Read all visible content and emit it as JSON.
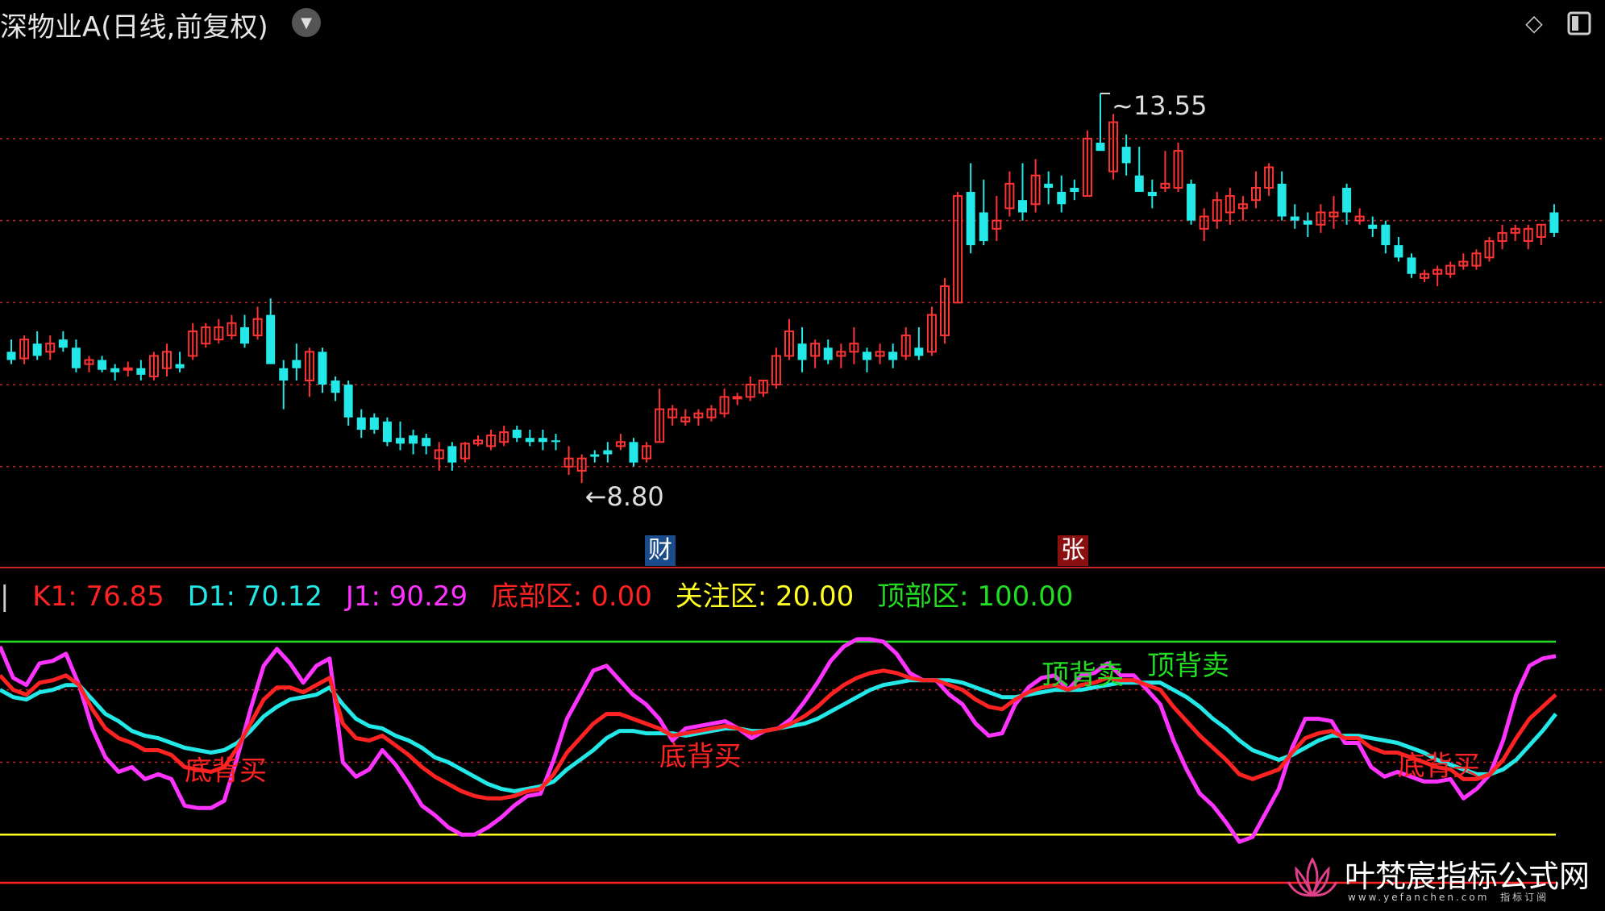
{
  "header": {
    "title": "深物业A(日线,前复权)"
  },
  "badges": {
    "cai": "财",
    "zhang": "张"
  },
  "legend": [
    {
      "key": "k1",
      "text": "K1: 76.85",
      "color": "#ff2222"
    },
    {
      "key": "d1",
      "text": "D1: 70.12",
      "color": "#22e8e8"
    },
    {
      "key": "j1",
      "text": "J1: 90.29",
      "color": "#ff33ff"
    },
    {
      "key": "bottom",
      "text": "底部区: 0.00",
      "color": "#ff2222"
    },
    {
      "key": "watch",
      "text": "关注区: 20.00",
      "color": "#ffff22"
    },
    {
      "key": "top",
      "text": "顶部区: 100.00",
      "color": "#22dd22"
    }
  ],
  "brand": {
    "name": "叶梵宸指标公式网",
    "sub": "www.yefanchen.com",
    "sub2": "指标订阅"
  },
  "colors": {
    "up": "#ff3333",
    "down": "#22e8e8",
    "k": "#ff2222",
    "d": "#22e8e8",
    "j": "#ff33ff",
    "grid": "#cc2222",
    "top": "#22dd22",
    "watch": "#ffff22",
    "bottom": "#ff2222"
  },
  "chart_data": [
    {
      "type": "candlestick",
      "title": "",
      "annotations": [
        {
          "label": "13.55",
          "kind": "high"
        },
        {
          "label": "8.80",
          "kind": "low"
        }
      ],
      "ylim": [
        8.3,
        14.1
      ],
      "candles": [
        [
          10.4,
          10.55,
          10.25,
          10.3
        ],
        [
          10.32,
          10.6,
          10.25,
          10.55
        ],
        [
          10.5,
          10.65,
          10.3,
          10.35
        ],
        [
          10.4,
          10.6,
          10.3,
          10.5
        ],
        [
          10.55,
          10.65,
          10.4,
          10.45
        ],
        [
          10.45,
          10.55,
          10.15,
          10.2
        ],
        [
          10.25,
          10.35,
          10.15,
          10.3
        ],
        [
          10.3,
          10.35,
          10.15,
          10.18
        ],
        [
          10.2,
          10.25,
          10.05,
          10.15
        ],
        [
          10.18,
          10.28,
          10.1,
          10.2
        ],
        [
          10.2,
          10.3,
          10.05,
          10.12
        ],
        [
          10.1,
          10.4,
          10.05,
          10.35
        ],
        [
          10.2,
          10.5,
          10.1,
          10.4
        ],
        [
          10.25,
          10.4,
          10.15,
          10.2
        ],
        [
          10.35,
          10.75,
          10.3,
          10.65
        ],
        [
          10.5,
          10.75,
          10.45,
          10.7
        ],
        [
          10.55,
          10.8,
          10.5,
          10.7
        ],
        [
          10.6,
          10.85,
          10.55,
          10.75
        ],
        [
          10.7,
          10.85,
          10.45,
          10.5
        ],
        [
          10.6,
          10.95,
          10.55,
          10.8
        ],
        [
          10.85,
          11.05,
          10.35,
          10.25
        ],
        [
          10.2,
          10.3,
          9.7,
          10.05
        ],
        [
          10.3,
          10.5,
          10.05,
          10.2
        ],
        [
          10.05,
          10.45,
          9.85,
          10.4
        ],
        [
          10.4,
          10.45,
          9.9,
          10.0
        ],
        [
          10.05,
          10.1,
          9.8,
          9.9
        ],
        [
          10.0,
          10.05,
          9.5,
          9.6
        ],
        [
          9.6,
          9.7,
          9.35,
          9.45
        ],
        [
          9.6,
          9.65,
          9.4,
          9.45
        ],
        [
          9.55,
          9.6,
          9.25,
          9.3
        ],
        [
          9.35,
          9.55,
          9.2,
          9.28
        ],
        [
          9.38,
          9.45,
          9.15,
          9.28
        ],
        [
          9.35,
          9.4,
          9.15,
          9.25
        ],
        [
          9.1,
          9.3,
          8.95,
          9.2
        ],
        [
          9.25,
          9.3,
          8.95,
          9.05
        ],
        [
          9.1,
          9.3,
          9.05,
          9.28
        ],
        [
          9.28,
          9.38,
          9.25,
          9.32
        ],
        [
          9.25,
          9.45,
          9.2,
          9.38
        ],
        [
          9.3,
          9.5,
          9.25,
          9.42
        ],
        [
          9.45,
          9.5,
          9.3,
          9.35
        ],
        [
          9.35,
          9.45,
          9.25,
          9.3
        ],
        [
          9.35,
          9.45,
          9.2,
          9.3
        ],
        [
          9.32,
          9.4,
          9.2,
          9.3
        ],
        [
          9.0,
          9.25,
          8.9,
          9.1
        ],
        [
          8.95,
          9.15,
          8.8,
          9.1
        ],
        [
          9.15,
          9.2,
          9.05,
          9.12
        ],
        [
          9.2,
          9.3,
          9.05,
          9.15
        ],
        [
          9.25,
          9.4,
          9.2,
          9.3
        ],
        [
          9.3,
          9.35,
          9.0,
          9.05
        ],
        [
          9.1,
          9.3,
          9.05,
          9.25
        ],
        [
          9.3,
          9.95,
          9.3,
          9.7
        ],
        [
          9.6,
          9.75,
          9.5,
          9.7
        ],
        [
          9.55,
          9.7,
          9.5,
          9.6
        ],
        [
          9.6,
          9.7,
          9.5,
          9.65
        ],
        [
          9.6,
          9.75,
          9.55,
          9.7
        ],
        [
          9.65,
          9.95,
          9.6,
          9.85
        ],
        [
          9.85,
          9.9,
          9.75,
          9.85
        ],
        [
          9.85,
          10.1,
          9.8,
          10.0
        ],
        [
          9.9,
          10.05,
          9.85,
          10.05
        ],
        [
          10.0,
          10.45,
          9.95,
          10.35
        ],
        [
          10.35,
          10.8,
          10.3,
          10.65
        ],
        [
          10.5,
          10.7,
          10.15,
          10.3
        ],
        [
          10.35,
          10.55,
          10.2,
          10.5
        ],
        [
          10.45,
          10.55,
          10.25,
          10.3
        ],
        [
          10.35,
          10.5,
          10.2,
          10.4
        ],
        [
          10.4,
          10.7,
          10.25,
          10.5
        ],
        [
          10.4,
          10.45,
          10.15,
          10.3
        ],
        [
          10.35,
          10.5,
          10.25,
          10.4
        ],
        [
          10.4,
          10.5,
          10.2,
          10.3
        ],
        [
          10.35,
          10.7,
          10.3,
          10.6
        ],
        [
          10.45,
          10.7,
          10.3,
          10.35
        ],
        [
          10.4,
          10.95,
          10.35,
          10.85
        ],
        [
          10.6,
          11.3,
          10.5,
          11.2
        ],
        [
          11.0,
          12.35,
          11.0,
          12.3
        ],
        [
          12.35,
          12.7,
          11.6,
          11.7
        ],
        [
          12.1,
          12.5,
          11.7,
          11.75
        ],
        [
          11.9,
          12.3,
          11.75,
          12.0
        ],
        [
          12.15,
          12.6,
          12.05,
          12.45
        ],
        [
          12.25,
          12.7,
          12.0,
          12.1
        ],
        [
          12.2,
          12.75,
          12.1,
          12.55
        ],
        [
          12.45,
          12.6,
          12.2,
          12.4
        ],
        [
          12.35,
          12.55,
          12.1,
          12.2
        ],
        [
          12.4,
          12.5,
          12.25,
          12.35
        ],
        [
          12.3,
          13.1,
          12.3,
          13.0
        ],
        [
          12.95,
          13.55,
          12.9,
          12.85
        ],
        [
          12.6,
          13.3,
          12.5,
          13.2
        ],
        [
          12.9,
          13.05,
          12.55,
          12.7
        ],
        [
          12.55,
          12.9,
          12.35,
          12.35
        ],
        [
          12.35,
          12.5,
          12.15,
          12.3
        ],
        [
          12.4,
          12.85,
          12.35,
          12.45
        ],
        [
          12.4,
          12.95,
          12.35,
          12.85
        ],
        [
          12.45,
          12.5,
          11.95,
          12.0
        ],
        [
          11.9,
          12.15,
          11.75,
          12.05
        ],
        [
          12.0,
          12.35,
          11.9,
          12.25
        ],
        [
          12.1,
          12.4,
          11.95,
          12.3
        ],
        [
          12.15,
          12.3,
          12.0,
          12.2
        ],
        [
          12.25,
          12.6,
          12.15,
          12.4
        ],
        [
          12.4,
          12.7,
          12.3,
          12.65
        ],
        [
          12.45,
          12.6,
          12.0,
          12.05
        ],
        [
          12.05,
          12.2,
          11.9,
          12.0
        ],
        [
          12.0,
          12.1,
          11.8,
          11.95
        ],
        [
          11.95,
          12.2,
          11.85,
          12.1
        ],
        [
          12.05,
          12.3,
          11.9,
          12.1
        ],
        [
          12.4,
          12.45,
          11.95,
          12.1
        ],
        [
          12.0,
          12.15,
          11.95,
          12.05
        ],
        [
          11.95,
          12.05,
          11.8,
          11.9
        ],
        [
          11.95,
          12.0,
          11.6,
          11.7
        ],
        [
          11.7,
          11.8,
          11.5,
          11.55
        ],
        [
          11.55,
          11.6,
          11.3,
          11.35
        ],
        [
          11.3,
          11.4,
          11.25,
          11.35
        ],
        [
          11.35,
          11.45,
          11.2,
          11.4
        ],
        [
          11.35,
          11.5,
          11.3,
          11.45
        ],
        [
          11.45,
          11.6,
          11.4,
          11.5
        ],
        [
          11.45,
          11.65,
          11.4,
          11.6
        ],
        [
          11.55,
          11.8,
          11.5,
          11.75
        ],
        [
          11.75,
          11.95,
          11.65,
          11.85
        ],
        [
          11.85,
          11.95,
          11.75,
          11.9
        ],
        [
          11.75,
          11.95,
          11.65,
          11.9
        ],
        [
          11.8,
          11.95,
          11.7,
          11.95
        ],
        [
          12.1,
          12.2,
          11.8,
          11.85
        ]
      ]
    },
    {
      "type": "line",
      "title": "",
      "ylim": [
        -5,
        112
      ],
      "series": [
        {
          "name": "K1",
          "values": [
            86,
            80,
            78,
            83,
            84,
            86,
            82,
            72,
            64,
            60,
            58,
            55,
            55,
            53,
            48,
            47,
            46,
            48,
            56,
            66,
            76,
            81,
            81,
            79,
            82,
            85,
            66,
            60,
            59,
            61,
            57,
            53,
            48,
            44,
            41,
            38,
            36,
            35,
            35,
            36,
            38,
            39,
            45,
            54,
            60,
            66,
            70,
            70,
            68,
            66,
            64,
            61,
            62,
            63,
            64,
            65,
            64,
            62,
            63,
            64,
            66,
            69,
            73,
            78,
            82,
            85,
            87,
            88,
            87,
            85,
            84,
            84,
            82,
            80,
            76,
            73,
            72,
            76,
            79,
            81,
            82,
            80,
            82,
            83,
            85,
            84,
            84,
            82,
            80,
            73,
            67,
            61,
            56,
            51,
            45,
            43,
            45,
            47,
            54,
            60,
            62,
            63,
            60,
            60,
            56,
            54,
            54,
            52,
            50,
            48,
            47,
            43,
            43,
            45,
            51,
            60,
            68,
            73,
            78
          ]
        },
        {
          "name": "D1",
          "values": [
            80,
            77,
            76,
            79,
            80,
            82,
            82,
            76,
            70,
            67,
            63,
            61,
            60,
            58,
            56,
            55,
            54,
            55,
            58,
            63,
            69,
            73,
            76,
            77,
            78,
            81,
            74,
            68,
            65,
            64,
            61,
            59,
            56,
            52,
            50,
            47,
            44,
            41,
            39,
            38,
            39,
            40,
            42,
            47,
            51,
            55,
            60,
            63,
            63,
            62,
            62,
            62,
            61,
            62,
            63,
            64,
            64,
            63,
            63,
            64,
            65,
            66,
            68,
            71,
            74,
            77,
            80,
            82,
            83,
            84,
            84,
            84,
            84,
            83,
            81,
            79,
            77,
            77,
            78,
            79,
            80,
            80,
            80,
            81,
            82,
            83,
            83,
            83,
            83,
            80,
            77,
            73,
            68,
            64,
            59,
            55,
            53,
            51,
            53,
            56,
            59,
            61,
            61,
            61,
            60,
            59,
            58,
            56,
            54,
            51,
            49,
            47,
            45,
            45,
            47,
            51,
            57,
            63,
            70
          ]
        },
        {
          "name": "J1",
          "values": [
            98,
            85,
            82,
            91,
            92,
            95,
            82,
            64,
            52,
            46,
            48,
            43,
            45,
            43,
            32,
            31,
            31,
            34,
            52,
            72,
            90,
            97,
            91,
            83,
            90,
            93,
            50,
            44,
            47,
            55,
            49,
            41,
            32,
            28,
            23,
            20,
            20,
            23,
            27,
            32,
            36,
            37,
            51,
            68,
            78,
            88,
            90,
            84,
            78,
            74,
            68,
            59,
            64,
            65,
            66,
            67,
            64,
            60,
            63,
            64,
            68,
            75,
            83,
            92,
            98,
            101,
            101,
            100,
            95,
            87,
            84,
            84,
            78,
            74,
            66,
            61,
            62,
            74,
            81,
            85,
            86,
            80,
            86,
            87,
            91,
            86,
            86,
            80,
            74,
            59,
            47,
            37,
            32,
            25,
            17,
            19,
            29,
            39,
            56,
            68,
            68,
            67,
            58,
            58,
            48,
            44,
            46,
            44,
            42,
            42,
            43,
            35,
            39,
            45,
            59,
            78,
            90,
            93,
            94
          ]
        }
      ],
      "levels": [
        {
          "name": "顶部区",
          "value": 100,
          "color": "#22dd22"
        },
        {
          "name": "关注区",
          "value": 20,
          "color": "#ffff22"
        },
        {
          "name": "底部区",
          "value": 0,
          "color": "#ff2222"
        }
      ],
      "signals": [
        {
          "label": "底背买",
          "index": 14,
          "color": "#ff2222"
        },
        {
          "label": "底背买",
          "index": 50,
          "color": "#ff2222"
        },
        {
          "label": "顶背卖",
          "index": 79,
          "color": "#22dd22"
        },
        {
          "label": "顶背卖",
          "index": 87,
          "color": "#22dd22"
        },
        {
          "label": "底背买",
          "index": 106,
          "color": "#ff2222"
        }
      ]
    }
  ]
}
